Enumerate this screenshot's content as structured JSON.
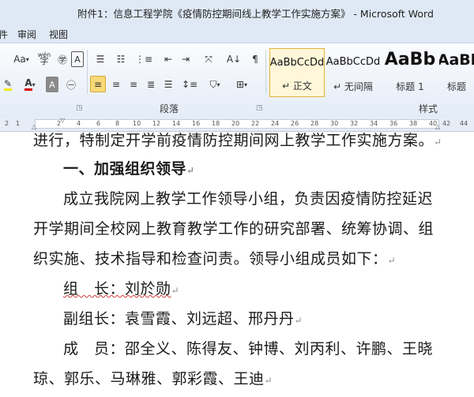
{
  "window": {
    "title": "附件1：信息工程学院《疫情防控期间线上教学工作实施方案》 - Microsoft Word"
  },
  "tabs": [
    "件",
    "审阅",
    "视图"
  ],
  "ribbon": {
    "font_menu": "Aa",
    "phonetic": "wén",
    "char_border": "A",
    "highlight": "ab",
    "font_color": "A",
    "char_shade": "A",
    "sort": "A↓",
    "show_marks": "¶",
    "group_paragraph": "段落",
    "group_styles": "样式",
    "styles": [
      {
        "sample": "AaBbCcDd",
        "name": "↵ 正文"
      },
      {
        "sample": "AaBbCcDd",
        "name": "↵ 无间隔"
      },
      {
        "sample": "AaBb",
        "name": "标题 1"
      },
      {
        "sample": "AaBl",
        "name": "标题"
      }
    ]
  },
  "ruler": {
    "numbers": [
      "2",
      "1",
      "2",
      "4",
      "6",
      "8",
      "10",
      "12",
      "14",
      "16",
      "18",
      "20",
      "22",
      "24",
      "26",
      "28",
      "30",
      "32",
      "34",
      "36",
      "38",
      "40",
      "42",
      "44"
    ]
  },
  "document": {
    "lines": [
      "进行，特制定开学前疫情防控期间网上教学工作实施方案。",
      "一、加强组织领导",
      "成立我院网上教学工作领导小组，负责因疫情防控延迟",
      "开学期间全校网上教育教学工作的研究部署、统筹协调、组",
      "织实施、技术指导和检查问责。领导小组成员如下：",
      "组　长：刘於勋",
      "副组长：袁雪霞、刘远超、邢丹丹",
      "成　员：邵全义、陈得友、钟博、刘丙利、许鹏、王晓",
      "琼、郭乐、马琳雅、郭彩霞、王迪"
    ],
    "para_mark": "↵"
  }
}
